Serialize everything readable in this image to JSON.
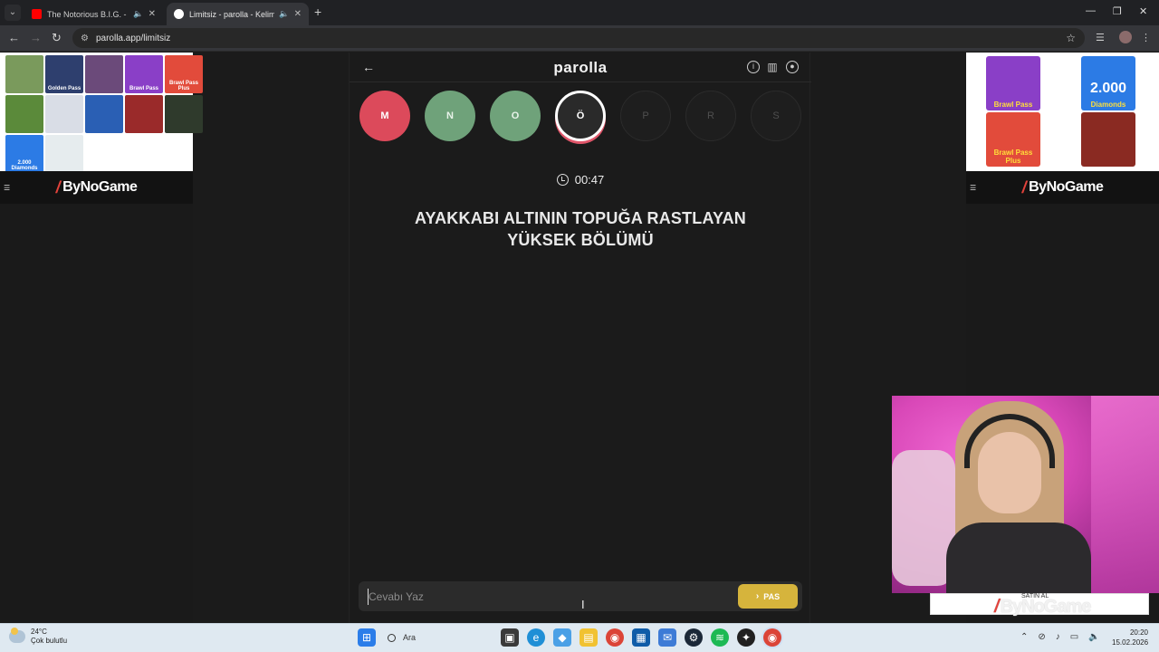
{
  "browser": {
    "tabs": [
      {
        "title": "The Notorious B.I.G. - Suicid",
        "active": false,
        "favicon_color": "#ff0000"
      },
      {
        "title": "Limitsiz - parolla - Kelime o",
        "active": true,
        "favicon_color": "#ffffff"
      }
    ],
    "url": "parolla.app/limitsiz"
  },
  "ads": {
    "brand_name": "ByNoGame",
    "left_products": [
      {
        "label": "",
        "color": "#7a9a5c"
      },
      {
        "label": "Golden Pass",
        "color": "#2e3f6e"
      },
      {
        "label": "",
        "color": "#6b4a7a"
      },
      {
        "label": "Brawl Pass",
        "color": "#8a3fc7"
      },
      {
        "label": "Brawl Pass Plus",
        "color": "#e24b3b"
      },
      {
        "label": "",
        "color": "#5b8a3a"
      },
      {
        "label": "",
        "color": "#d9dde6"
      },
      {
        "label": "",
        "color": "#2a5fb4"
      },
      {
        "label": "",
        "color": "#9a2a2a"
      },
      {
        "label": "",
        "color": "#2f3a2c"
      },
      {
        "label": "2.000 Diamonds",
        "color": "#2c7be5"
      },
      {
        "label": "",
        "color": "#e6ecee"
      }
    ],
    "right_products": [
      {
        "label": "Brawl Pass",
        "big": "",
        "color": "#8a3fc7"
      },
      {
        "label": "Diamonds",
        "big": "2.000",
        "color": "#2c7be5"
      },
      {
        "label": "Brawl Pass Plus",
        "big": "",
        "color": "#e24b3b"
      },
      {
        "label": "",
        "big": "",
        "color": "#8a2a22"
      }
    ]
  },
  "game": {
    "logo": "parolla",
    "letters": [
      {
        "char": "M",
        "state": "wrong"
      },
      {
        "char": "N",
        "state": "right"
      },
      {
        "char": "O",
        "state": "right"
      },
      {
        "char": "Ö",
        "state": "current"
      },
      {
        "char": "P",
        "state": "pending"
      },
      {
        "char": "R",
        "state": "pending"
      },
      {
        "char": "S",
        "state": "pending"
      }
    ],
    "timer": "00:47",
    "question": "AYAKKABI ALTININ TOPUĞA RASTLAYAN YÜKSEK BÖLÜMÜ",
    "answer_placeholder": "Cevabı Yaz",
    "answer_value": "",
    "pass_label": "PAS"
  },
  "stream_overlay": {
    "buy_label": "SATIN AL",
    "watermark": "ByNoGame"
  },
  "taskbar": {
    "weather_temp": "24°C",
    "weather_desc": "Çok bulutlu",
    "search_label": "Ara",
    "time": "20:20",
    "date": "15.02.2026"
  },
  "colors": {
    "wrong": "#dc4a5b",
    "right": "#6fa27a",
    "pass_button": "#d6b43c",
    "page_bg": "#1b1b1b"
  }
}
